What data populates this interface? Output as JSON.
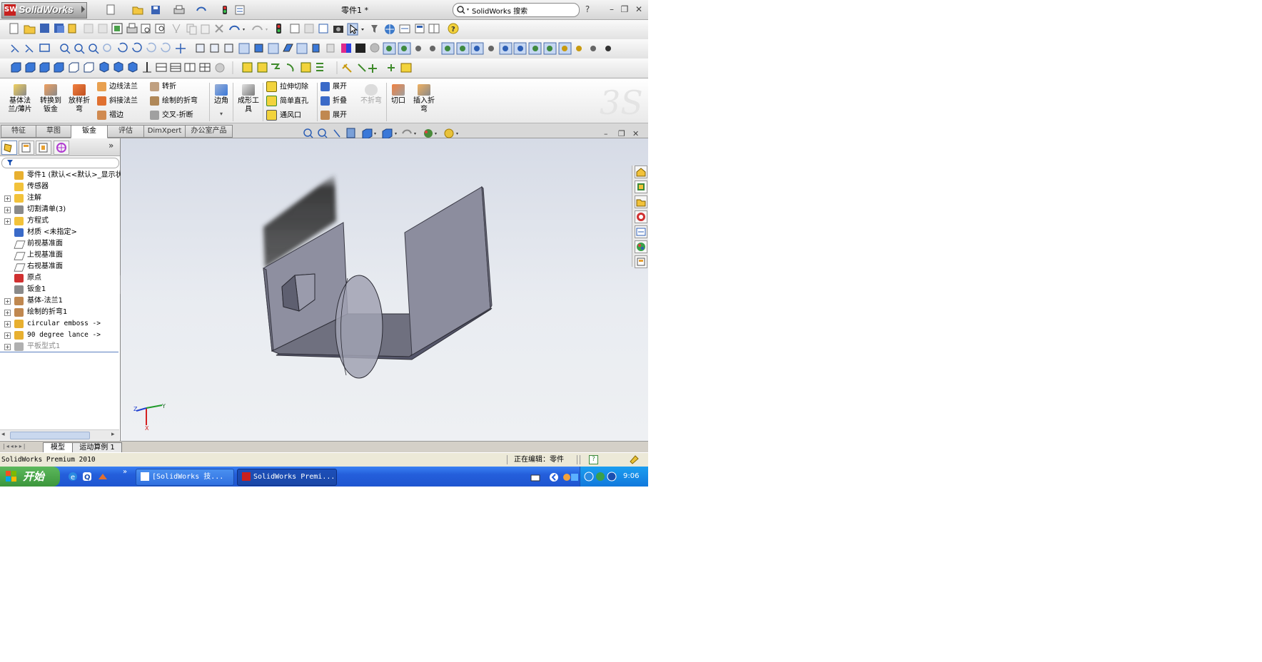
{
  "app": {
    "logo_text": "SolidWorks",
    "logo_mark": "SW",
    "doc_title": "零件1 *"
  },
  "search": {
    "placeholder": "SolidWorks 搜索"
  },
  "title_buttons": {
    "help": "?",
    "minimize": "–",
    "restore": "❐",
    "close": "✕"
  },
  "command_manager": {
    "big_buttons": [
      {
        "label": "基体法兰/薄片"
      },
      {
        "label": "转换到钣金"
      },
      {
        "label": "放样折弯"
      },
      {
        "label": "边角"
      },
      {
        "label": "成形工具"
      },
      {
        "label": "不折弯"
      },
      {
        "label": "切口"
      },
      {
        "label": "插入折弯"
      }
    ],
    "small_buttons": [
      {
        "label": "边线法兰"
      },
      {
        "label": "斜接法兰"
      },
      {
        "label": "褶边"
      },
      {
        "label": "转折"
      },
      {
        "label": "绘制的折弯"
      },
      {
        "label": "交叉-折断"
      },
      {
        "label": "拉伸切除"
      },
      {
        "label": "简单直孔"
      },
      {
        "label": "通风口"
      },
      {
        "label": "展开"
      },
      {
        "label": "折叠"
      },
      {
        "label": "展开"
      }
    ]
  },
  "tabs": [
    "特征",
    "草图",
    "钣金",
    "评估",
    "DimXpert",
    "办公室产品"
  ],
  "feature_tree": [
    {
      "label": "零件1  (默认<<默认>_显示状态",
      "icon": "part-icon",
      "expander": "",
      "grey": false,
      "mono": false
    },
    {
      "label": "传感器",
      "icon": "sensor-icon",
      "expander": "",
      "grey": false,
      "mono": false
    },
    {
      "label": "注解",
      "icon": "annotation-icon",
      "expander": "+",
      "grey": false,
      "mono": false
    },
    {
      "label": "切割清单(3)",
      "icon": "cut-list-icon",
      "expander": "+",
      "grey": false,
      "mono": false
    },
    {
      "label": "方程式",
      "icon": "equation-icon",
      "expander": "+",
      "grey": false,
      "mono": false
    },
    {
      "label": "材质 <未指定>",
      "icon": "material-icon",
      "expander": "",
      "grey": false,
      "mono": false
    },
    {
      "label": "前视基准面",
      "icon": "plane-icon",
      "expander": "",
      "grey": false,
      "mono": false
    },
    {
      "label": "上视基准面",
      "icon": "plane-icon",
      "expander": "",
      "grey": false,
      "mono": false
    },
    {
      "label": "右视基准面",
      "icon": "plane-icon",
      "expander": "",
      "grey": false,
      "mono": false
    },
    {
      "label": "原点",
      "icon": "origin-icon",
      "expander": "",
      "grey": false,
      "mono": false
    },
    {
      "label": "钣金1",
      "icon": "sheet-metal-icon",
      "expander": "",
      "grey": false,
      "mono": false
    },
    {
      "label": "基体-法兰1",
      "icon": "base-flange-icon",
      "expander": "+",
      "grey": false,
      "mono": false
    },
    {
      "label": "绘制的折弯1",
      "icon": "sketched-bend-icon",
      "expander": "+",
      "grey": false,
      "mono": false
    },
    {
      "label": "circular emboss ->",
      "icon": "library-feature-icon",
      "expander": "+",
      "grey": false,
      "mono": true
    },
    {
      "label": "90 degree lance ->",
      "icon": "library-feature-icon",
      "expander": "+",
      "grey": false,
      "mono": true
    },
    {
      "label": "平板型式1",
      "icon": "flat-pattern-icon",
      "expander": "+",
      "grey": true,
      "mono": false
    }
  ],
  "triad": {
    "x": "X",
    "y": "Y",
    "z": "Z"
  },
  "model_tabs": [
    "模型",
    "运动算例 1"
  ],
  "status_bar": {
    "product": "SolidWorks Premium 2010",
    "editing": "正在编辑：零件",
    "help": "?"
  },
  "taskbar": {
    "start": "开始",
    "tasks": [
      "[SolidWorks 技...",
      "SolidWorks Premi..."
    ],
    "clock": "9:06",
    "expand": "»"
  },
  "colors": {
    "sw_red": "#c8201e",
    "xp_blue": "#245edb",
    "xp_green": "#3c963c",
    "model_grey": "#7e7f8e"
  }
}
